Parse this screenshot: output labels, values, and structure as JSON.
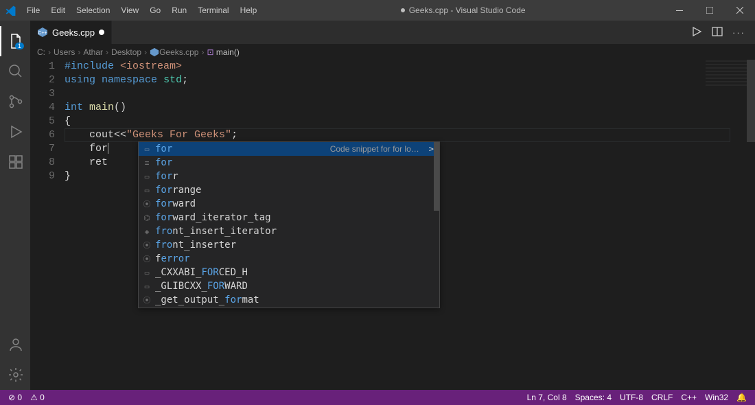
{
  "titlebar": {
    "menu": [
      "File",
      "Edit",
      "Selection",
      "View",
      "Go",
      "Run",
      "Terminal",
      "Help"
    ],
    "center": "Geeks.cpp - Visual Studio Code"
  },
  "tab": {
    "label": "Geeks.cpp"
  },
  "breadcrumb": [
    "C:",
    "Users",
    "Athar",
    "Desktop",
    "Geeks.cpp",
    "main()"
  ],
  "code": {
    "lines": [
      {
        "n": 1,
        "html": "<span class='k'>#include</span> <span class='s'>&lt;iostream&gt;</span>"
      },
      {
        "n": 2,
        "html": "<span class='k'>using</span> <span class='k'>namespace</span> <span class='t'>std</span><span class='d'>;</span>"
      },
      {
        "n": 3,
        "html": ""
      },
      {
        "n": 4,
        "html": "<span class='k'>int</span> <span class='b'>main</span><span class='d'>()</span>"
      },
      {
        "n": 5,
        "html": "<span class='d'>{</span>"
      },
      {
        "n": 6,
        "html": "    <span class='d'>cout&lt;&lt;</span><span class='s'>\"Geeks For Geeks\"</span><span class='d'>;</span>"
      },
      {
        "n": 7,
        "html": "    <span class='d'>for</span><span class='cursor'></span>"
      },
      {
        "n": 8,
        "html": "    <span class='d'>ret</span>"
      },
      {
        "n": 9,
        "html": "<span class='d'>}</span>"
      }
    ]
  },
  "suggest": {
    "desc": "Code snippet for for lo…",
    "items": [
      {
        "icon": "▭",
        "hi": "for",
        "rest": "",
        "sel": true
      },
      {
        "icon": "≡",
        "hi": "for",
        "rest": ""
      },
      {
        "icon": "▭",
        "hi": "for",
        "rest": "r"
      },
      {
        "icon": "▭",
        "hi": "for",
        "rest": "range"
      },
      {
        "icon": "⦿",
        "hi": "for",
        "rest": "ward"
      },
      {
        "icon": "⌬",
        "hi": "for",
        "rest": "ward_iterator_tag"
      },
      {
        "icon": "◈",
        "hi": "fro",
        "rest": "nt_insert_iterator"
      },
      {
        "icon": "⦿",
        "hi": "fro",
        "rest": "nt_inserter"
      },
      {
        "icon": "⦿",
        "pre": "f",
        "hi2": "err",
        "mid": "",
        "hi3": "or",
        "custom": true,
        "raw": "ferror",
        "hipos": [
          1,
          4,
          6
        ]
      },
      {
        "icon": "▭",
        "customText": true,
        "segments": [
          {
            "t": "_CXXABI_",
            "hi": false
          },
          {
            "t": "FOR",
            "hi": true
          },
          {
            "t": "CED_H",
            "hi": false
          }
        ]
      },
      {
        "icon": "▭",
        "customText": true,
        "segments": [
          {
            "t": "_GLIBCXX_",
            "hi": false
          },
          {
            "t": "FOR",
            "hi": true
          },
          {
            "t": "WARD",
            "hi": false
          }
        ]
      },
      {
        "icon": "⦿",
        "customText": true,
        "segments": [
          {
            "t": "_get_output_",
            "hi": false
          },
          {
            "t": "for",
            "hi": true
          },
          {
            "t": "mat",
            "hi": false
          }
        ]
      }
    ]
  },
  "statusbar": {
    "left": [
      "⊘ 0",
      "⚠ 0"
    ],
    "right": [
      "Ln 7, Col 8",
      "Spaces: 4",
      "UTF-8",
      "CRLF",
      "C++",
      "Win32",
      "🔔"
    ]
  }
}
